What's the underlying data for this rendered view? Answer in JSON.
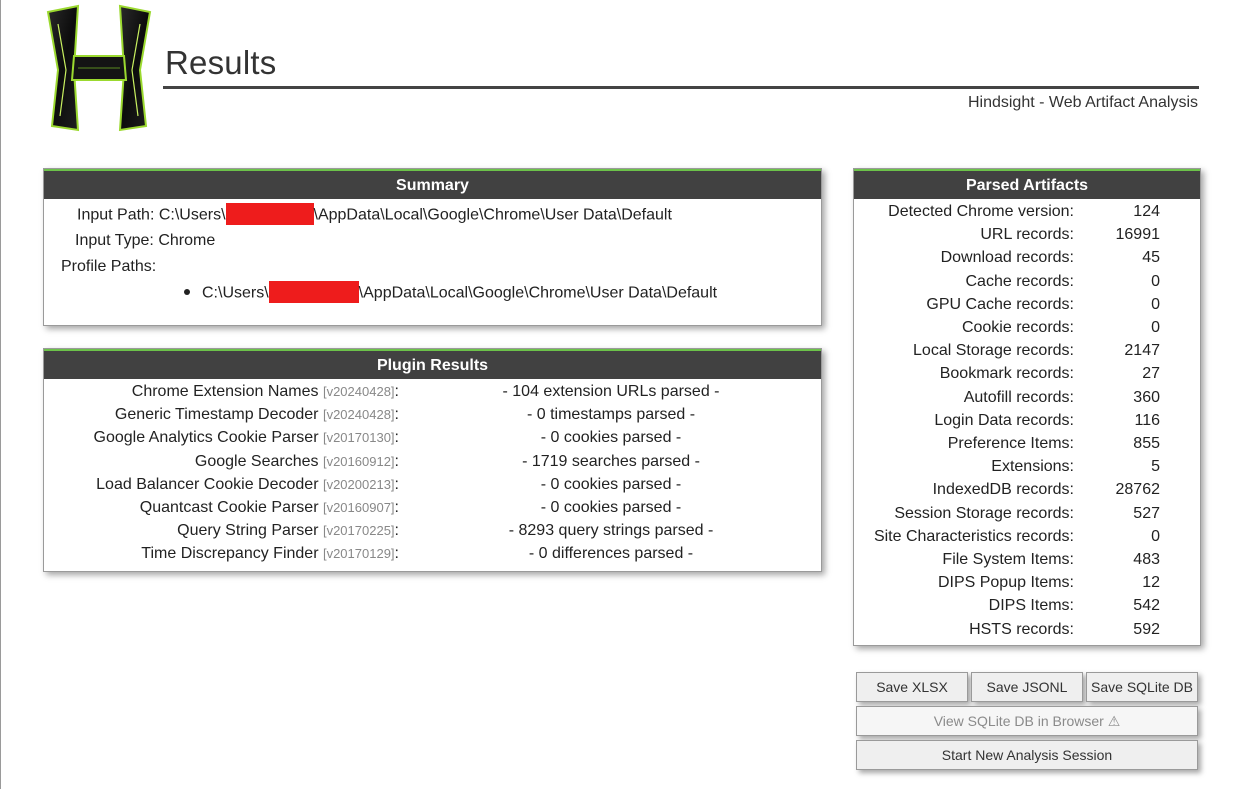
{
  "header": {
    "title": "Results",
    "subtitle": "Hindsight - Web Artifact Analysis"
  },
  "summary": {
    "heading": "Summary",
    "input_path_label": "Input Path:",
    "input_path_prefix": "C:\\Users\\",
    "input_path_suffix": "\\AppData\\Local\\Google\\Chrome\\User Data\\Default",
    "input_type_label": "Input Type:",
    "input_type_value": "Chrome",
    "profile_paths_label": "Profile Paths:",
    "profile_path_prefix": "C:\\Users\\",
    "profile_path_suffix": "\\AppData\\Local\\Google\\Chrome\\User Data\\Default"
  },
  "plugins": {
    "heading": "Plugin Results",
    "rows": [
      {
        "name": "Chrome Extension Names",
        "version": "[v20240428]",
        "result": "- 104 extension URLs parsed -"
      },
      {
        "name": "Generic Timestamp Decoder",
        "version": "[v20240428]",
        "result": "- 0 timestamps parsed -"
      },
      {
        "name": "Google Analytics Cookie Parser",
        "version": "[v20170130]",
        "result": "- 0 cookies parsed -"
      },
      {
        "name": "Google Searches",
        "version": "[v20160912]",
        "result": "- 1719 searches parsed -"
      },
      {
        "name": "Load Balancer Cookie Decoder",
        "version": "[v20200213]",
        "result": "- 0 cookies parsed -"
      },
      {
        "name": "Quantcast Cookie Parser",
        "version": "[v20160907]",
        "result": "- 0 cookies parsed -"
      },
      {
        "name": "Query String Parser",
        "version": "[v20170225]",
        "result": "- 8293 query strings parsed -"
      },
      {
        "name": "Time Discrepancy Finder",
        "version": "[v20170129]",
        "result": "- 0 differences parsed -"
      }
    ]
  },
  "artifacts": {
    "heading": "Parsed Artifacts",
    "rows": [
      {
        "label": "Detected Chrome version:",
        "value": "124"
      },
      {
        "label": "URL records:",
        "value": "16991"
      },
      {
        "label": "Download records:",
        "value": "45"
      },
      {
        "label": "Cache records:",
        "value": "0"
      },
      {
        "label": "GPU Cache records:",
        "value": "0"
      },
      {
        "label": "Cookie records:",
        "value": "0"
      },
      {
        "label": "Local Storage records:",
        "value": "2147"
      },
      {
        "label": "Bookmark records:",
        "value": "27"
      },
      {
        "label": "Autofill records:",
        "value": "360"
      },
      {
        "label": "Login Data records:",
        "value": "116"
      },
      {
        "label": "Preference Items:",
        "value": "855"
      },
      {
        "label": "Extensions:",
        "value": "5"
      },
      {
        "label": "IndexedDB records:",
        "value": "28762"
      },
      {
        "label": "Session Storage records:",
        "value": "527"
      },
      {
        "label": "Site Characteristics records:",
        "value": "0"
      },
      {
        "label": "File System Items:",
        "value": "483"
      },
      {
        "label": "DIPS Popup Items:",
        "value": "12"
      },
      {
        "label": "DIPS Items:",
        "value": "542"
      },
      {
        "label": "HSTS records:",
        "value": "592"
      }
    ]
  },
  "buttons": {
    "save_xlsx": "Save XLSX",
    "save_jsonl": "Save JSONL",
    "save_sqlite": "Save SQLite DB",
    "view_sqlite": "View SQLite DB in Browser ⚠",
    "new_session": "Start New Analysis Session"
  },
  "colors": {
    "panel_header": "#414141",
    "accent": "#6cc24a",
    "redaction": "#ee1c1c"
  }
}
